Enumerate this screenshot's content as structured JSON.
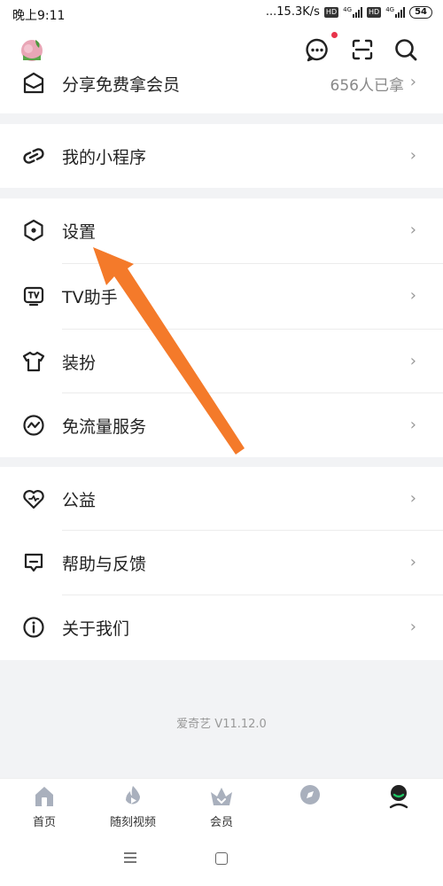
{
  "status_bar": {
    "time": "晚上9:11",
    "net_speed": "...15.3K/s",
    "hd_label": "HD",
    "net_type": "4G",
    "battery": "54"
  },
  "header": {
    "icons": [
      "avatar",
      "message-icon",
      "scan-icon",
      "search-icon"
    ],
    "has_message_badge": true
  },
  "menu": {
    "share": {
      "label": "分享免费拿会员",
      "right_text": "656人已拿",
      "chevron": "›"
    },
    "miniprogram": {
      "label": "我的小程序",
      "chevron": "›"
    },
    "settings": {
      "label": "设置",
      "chevron": "›"
    },
    "tv": {
      "label": "TV助手",
      "chevron": "›"
    },
    "dressup": {
      "label": "装扮",
      "chevron": "›"
    },
    "free_traffic": {
      "label": "免流量服务",
      "chevron": "›"
    },
    "charity": {
      "label": "公益",
      "chevron": "›"
    },
    "help": {
      "label": "帮助与反馈",
      "chevron": "›"
    },
    "about": {
      "label": "关于我们",
      "chevron": "›"
    }
  },
  "version": "爱奇艺 V11.12.0",
  "tabbar": {
    "home": "首页",
    "shorts": "随刻视频",
    "vip": "会员",
    "discover": "",
    "me": ""
  },
  "colors": {
    "accent_arrow": "#f47a2a",
    "badge_red": "#e8334a",
    "icon_gray": "#a9b0bd",
    "me_green": "#1ec764"
  }
}
